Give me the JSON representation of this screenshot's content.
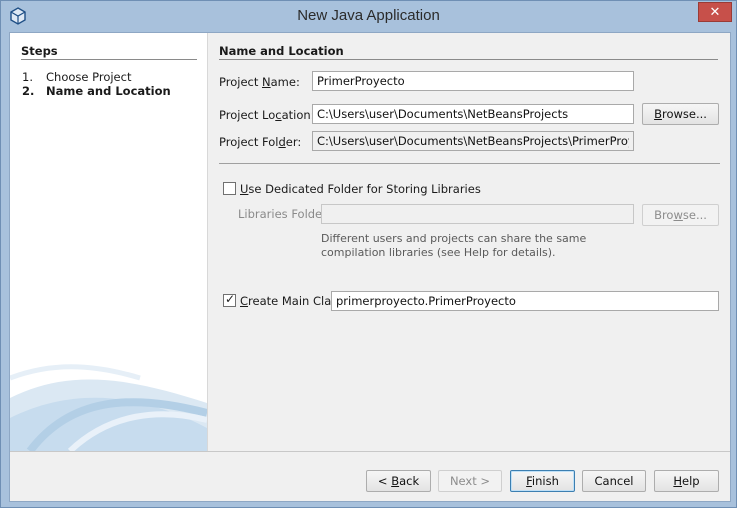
{
  "window": {
    "title": "New Java Application",
    "close_glyph": "✕"
  },
  "steps": {
    "title": "Steps",
    "items": [
      {
        "num": "1.",
        "label": "Choose Project",
        "current": false
      },
      {
        "num": "2.",
        "label": "Name and Location",
        "current": true
      }
    ]
  },
  "section": {
    "title": "Name and Location"
  },
  "fields": {
    "project_name": {
      "label_pre": "Project ",
      "label_mn": "N",
      "label_post": "ame:",
      "value": "PrimerProyecto"
    },
    "project_location": {
      "label_pre": "Project Lo",
      "label_mn": "c",
      "label_post": "ation:",
      "value": "C:\\Users\\user\\Documents\\NetBeansProjects"
    },
    "project_folder": {
      "label_pre": "Project Fol",
      "label_mn": "d",
      "label_post": "er:",
      "value": "C:\\Users\\user\\Documents\\NetBeansProjects\\PrimerProyecto"
    },
    "libraries_folder": {
      "label": "Libraries Folder:",
      "value": ""
    }
  },
  "browse_buttons": {
    "location": {
      "pre": "Browse",
      "mn": "",
      "post": "...",
      "label_mn_pre": "B",
      "label_rest": "rowse..."
    },
    "libraries": {
      "label_pre": "Bro",
      "label_mn": "w",
      "label_post": "se..."
    }
  },
  "dedicated_folder": {
    "checked": false,
    "label_mn": "U",
    "label_post": "se Dedicated Folder for Storing Libraries"
  },
  "help_text": "Different users and projects can share the same compilation libraries (see Help for details).",
  "main_class": {
    "checked": true,
    "label_mn": "C",
    "label_post": "reate Main Class",
    "value": "primerproyecto.PrimerProyecto"
  },
  "buttons": {
    "back": {
      "pre": "< ",
      "mn": "B",
      "post": "ack"
    },
    "next": {
      "label": "Next >"
    },
    "finish": {
      "mn": "F",
      "post": "inish"
    },
    "cancel": {
      "label": "Cancel"
    },
    "help": {
      "mn": "H",
      "post": "elp"
    }
  },
  "colors": {
    "titlebar": "#a8c1dc",
    "close": "#c7504a",
    "panel": "#f0f0f0"
  }
}
